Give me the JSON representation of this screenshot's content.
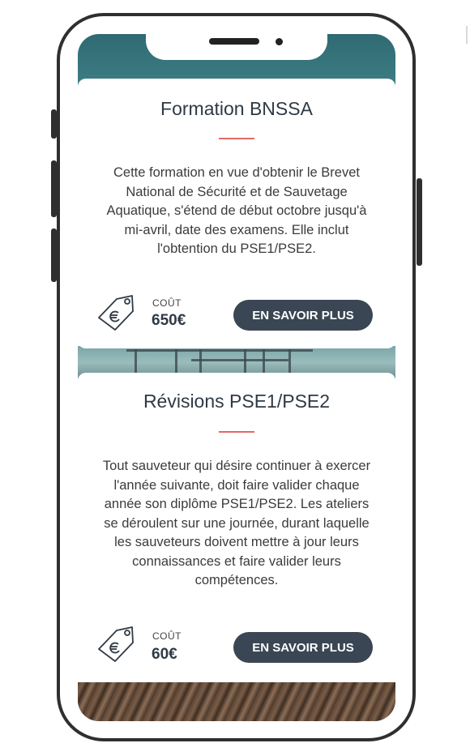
{
  "cards": [
    {
      "title": "Formation BNSSA",
      "description": "Cette formation en vue d'obtenir le Brevet National de Sécurité et de Sauvetage Aquatique, s'étend de début octobre jusqu'à mi-avril, date des examens. Elle inclut l'obtention du PSE1/PSE2.",
      "cost_label": "COÛT",
      "price": "650€",
      "button_label": "EN SAVOIR PLUS"
    },
    {
      "title": "Révisions PSE1/PSE2",
      "description": "Tout sauveteur qui désire continuer à exercer l'année suivante, doit faire valider chaque année son diplôme PSE1/PSE2. Les ateliers se déroulent sur une journée, durant laquelle les sauveteurs doivent mettre à jour leurs connaissances et faire valider leurs compétences.",
      "cost_label": "COÛT",
      "price": "60€",
      "button_label": "EN SAVOIR PLUS"
    }
  ],
  "icons": {
    "price_tag": "price-tag-euro-icon"
  },
  "colors": {
    "button_bg": "#3a4654",
    "title_accent": "#e06b66",
    "text_dark": "#2f3a45"
  }
}
